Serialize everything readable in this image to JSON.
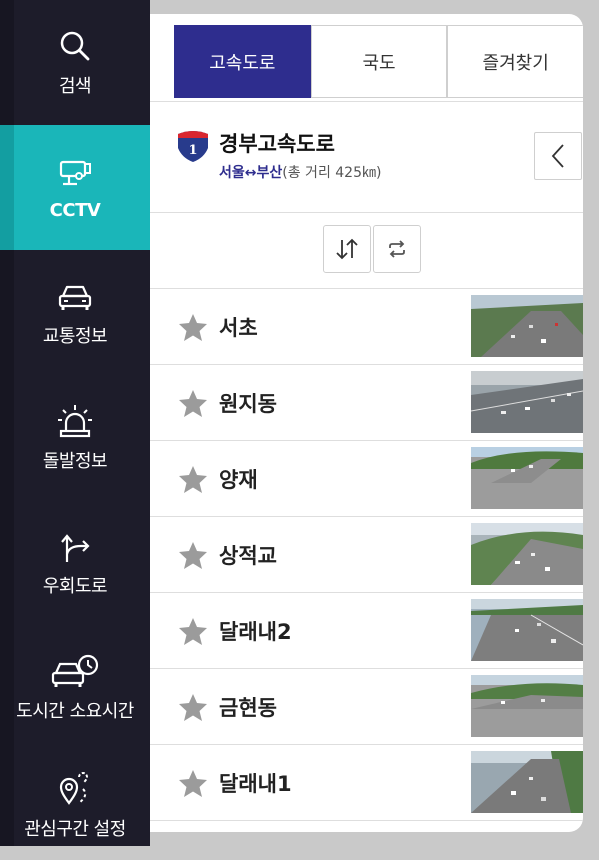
{
  "nav": {
    "items": [
      {
        "label": "검색",
        "icon": "search-icon"
      },
      {
        "label": "CCTV",
        "icon": "cctv-camera-icon",
        "active": true
      },
      {
        "label": "교통정보",
        "icon": "car-icon"
      },
      {
        "label": "돌발정보",
        "icon": "siren-icon"
      },
      {
        "label": "우회도로",
        "icon": "detour-arrow-icon"
      },
      {
        "label": "도시간 소요시간",
        "icon": "car-clock-icon"
      },
      {
        "label": "관심구간 설정",
        "icon": "location-route-icon"
      }
    ]
  },
  "tabs": [
    {
      "label": "고속도로",
      "active": true
    },
    {
      "label": "국도"
    },
    {
      "label": "즐겨찾기"
    }
  ],
  "route": {
    "shield_number": "1",
    "name": "경부고속도로",
    "ends": "서울↔부산",
    "distance": "(총 거리 425㎞)"
  },
  "cctv_list": [
    {
      "name": "서초"
    },
    {
      "name": "원지동"
    },
    {
      "name": "양재"
    },
    {
      "name": "상적교"
    },
    {
      "name": "달래내2"
    },
    {
      "name": "금현동"
    },
    {
      "name": "달래내1"
    }
  ],
  "colors": {
    "accent_teal": "#1ab6b9",
    "tab_active": "#2e2d8e",
    "sidebar_bg": "#1d1c2a",
    "star": "#9b9b9b"
  }
}
